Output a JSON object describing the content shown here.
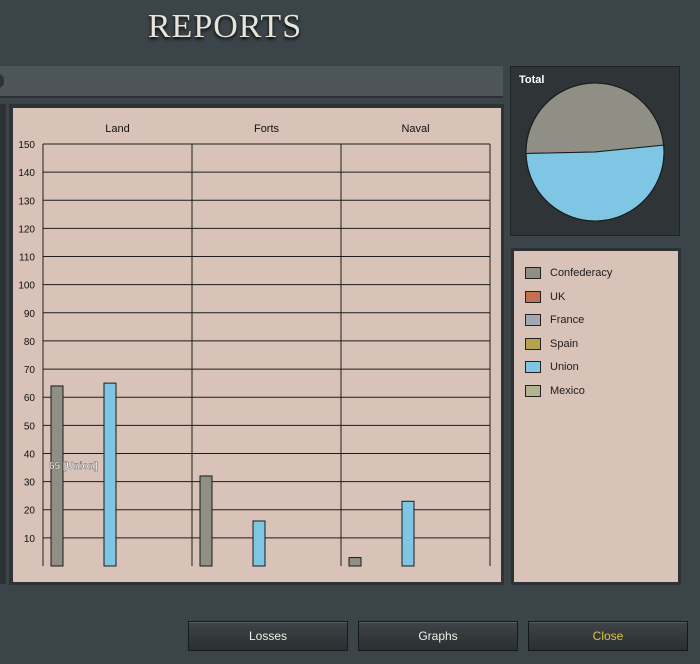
{
  "page": {
    "title": "REPORTS"
  },
  "pie": {
    "label": "Total"
  },
  "legend": [
    {
      "label": "Confederacy",
      "color": "#8f8f86"
    },
    {
      "label": "UK",
      "color": "#c27052"
    },
    {
      "label": "France",
      "color": "#a2a8b3"
    },
    {
      "label": "Spain",
      "color": "#b6a24a"
    },
    {
      "label": "Union",
      "color": "#7ec6e3"
    },
    {
      "label": "Mexico",
      "color": "#b1b48c"
    }
  ],
  "buttons": {
    "losses": "Losses",
    "graphs": "Graphs",
    "close": "Close"
  },
  "chart_data": {
    "type": "bar",
    "categories": [
      "Land",
      "Forts",
      "Naval"
    ],
    "series": [
      {
        "name": "Confederacy",
        "color": "#8f8f86",
        "values": [
          64,
          32,
          3
        ]
      },
      {
        "name": "Union",
        "color": "#7ec6e3",
        "values": [
          65,
          16,
          23
        ]
      }
    ],
    "ylim": [
      0,
      150
    ],
    "yticks": [
      10,
      20,
      30,
      40,
      50,
      60,
      70,
      80,
      90,
      100,
      110,
      120,
      130,
      140,
      150
    ],
    "grid": true,
    "tooltip": "65 [Union]",
    "pie": {
      "label": "Total",
      "slices": [
        {
          "name": "Confederacy",
          "value": 99
        },
        {
          "name": "Union",
          "value": 104
        }
      ]
    }
  }
}
